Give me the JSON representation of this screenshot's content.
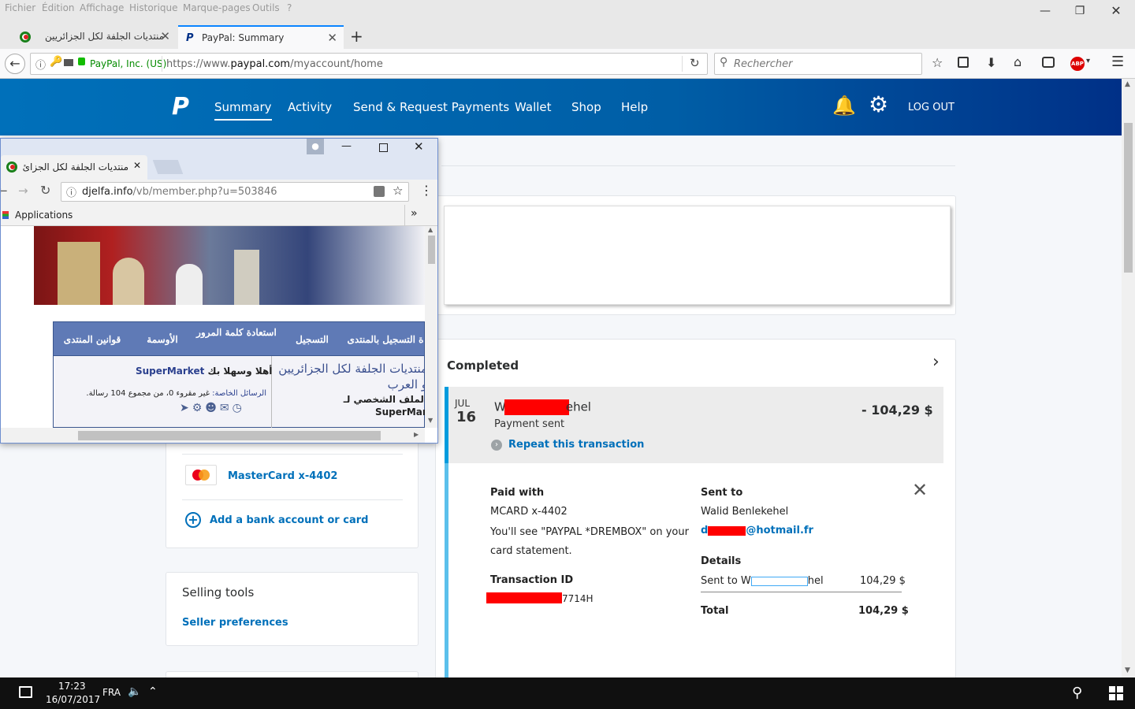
{
  "firefox": {
    "menu": [
      "Fichier",
      "Édition",
      "Affichage",
      "Historique",
      "Marque-pages",
      "Outils",
      "?"
    ],
    "tabs": [
      {
        "label": "منتديات الجلفة لكل الجزائريين",
        "active": false
      },
      {
        "label": "PayPal: Summary",
        "active": true
      }
    ],
    "new_tab": "+",
    "identity": "PayPal, Inc. (US)",
    "url_prefix": "https://www.",
    "url_domain": "paypal.com",
    "url_path": "/myaccount/home",
    "search_placeholder": "Rechercher"
  },
  "paypal": {
    "nav": [
      "Summary",
      "Activity",
      "Send & Request Payments",
      "Wallet",
      "Shop",
      "Help"
    ],
    "logout": "LOG OUT",
    "wallet": {
      "card_label": "MasterCard x-4402",
      "add_bank": "Add a bank account or card"
    },
    "selling_tools": {
      "title": "Selling tools",
      "link": "Seller preferences"
    },
    "activity": {
      "section": "Completed",
      "month": "JUL",
      "day": "16",
      "name_start": "W",
      "name_end": "ehel",
      "subtitle": "Payment sent",
      "amount": "- 104,29 $",
      "repeat": "Repeat this transaction"
    },
    "details": {
      "paid_with_label": "Paid with",
      "paid_with_value": "MCARD x-4402",
      "statement_note": "You'll see \"PAYPAL *DREMBOX\" on your card statement.",
      "txn_label": "Transaction ID",
      "txn_suffix": "7714H",
      "sent_to_label": "Sent to",
      "recipient_name": "Walid Benlekehel",
      "email_start": "d",
      "email_end": "@hotmail.fr",
      "details_label": "Details",
      "line_start": "Sent to W",
      "line_end": "hel",
      "line_amount": "104,29 $",
      "total_label": "Total",
      "total_amount": "104,29 $"
    }
  },
  "chrome_popup": {
    "tab_title": "منتديات الجلفة لكل الجزائ",
    "url_host": "djelfa.info",
    "url_path": "/vb/member.php?u=503846",
    "bookmarks_apps": "Applications",
    "more_bookmarks": "»",
    "forum_nav": [
      "قوانين المنتدى",
      "الأوسمة",
      "استعادة كلمة المرور",
      "التسجيل",
      "ة التسجيل بالمنتدى"
    ],
    "forum_title": "منتديات الجلفة لكل الجزائريين و العرب",
    "profile_line": "الملف الشخصي لـ",
    "profile_user": "SuperMar",
    "welcome_prefix": "أهلا وسهلا بك",
    "welcome_user": "SuperMarket",
    "private_messages": "الرسائل الخاصة:",
    "messages_stats": "غير مقروء 0، من مجموع 104 رسالة."
  },
  "taskbar": {
    "time": "17:23",
    "date": "16/07/2017",
    "lang": "FRA"
  }
}
